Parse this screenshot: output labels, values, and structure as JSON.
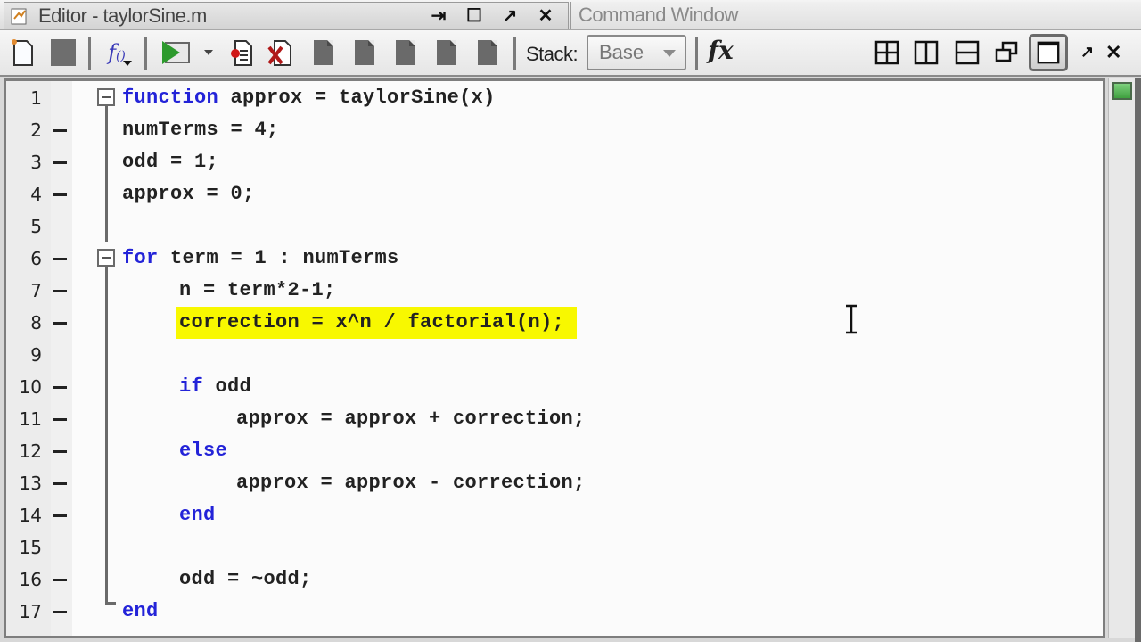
{
  "titlebar": {
    "editor_title": "Editor - taylorSine.m",
    "command_window_title": "Command Window",
    "controls": {
      "dock": "⇥",
      "maximize": "☐",
      "undock": "↗",
      "close": "✕"
    }
  },
  "toolbar": {
    "buttons": [
      {
        "name": "new-file",
        "icon": "new-file-icon"
      },
      {
        "name": "save",
        "icon": "save-icon"
      },
      {
        "name": "insert-function",
        "icon": "function-icon"
      },
      {
        "name": "run",
        "icon": "run-icon"
      },
      {
        "name": "run-options",
        "icon": "dropdown-arrow-icon"
      },
      {
        "name": "set-breakpoint",
        "icon": "breakpoint-icon"
      },
      {
        "name": "clear-breakpoints",
        "icon": "clear-breakpoints-icon"
      },
      {
        "name": "step",
        "icon": "step-icon"
      },
      {
        "name": "step-in",
        "icon": "step-in-icon"
      },
      {
        "name": "step-out",
        "icon": "step-out-icon"
      },
      {
        "name": "continue",
        "icon": "continue-icon"
      },
      {
        "name": "exit-debug",
        "icon": "exit-debug-icon"
      }
    ],
    "stack_label": "Stack:",
    "stack_value": "Base",
    "fx_label": "fx",
    "layout_buttons": [
      "tile-2x2",
      "split-columns",
      "split-rows",
      "float",
      "single"
    ],
    "undock": "↗",
    "close": "✕"
  },
  "editor": {
    "highlight_color": "#f8f800",
    "keyword_color": "#2323d8",
    "lines": [
      {
        "num": "1",
        "breakpoint_dash": false,
        "indent": 0,
        "tokens": [
          [
            "kw",
            "function"
          ],
          [
            "t",
            " approx = taylorSine(x)"
          ]
        ]
      },
      {
        "num": "2",
        "breakpoint_dash": true,
        "indent": 0,
        "tokens": [
          [
            "t",
            "numTerms = 4;"
          ]
        ]
      },
      {
        "num": "3",
        "breakpoint_dash": true,
        "indent": 0,
        "tokens": [
          [
            "t",
            "odd = 1;"
          ]
        ]
      },
      {
        "num": "4",
        "breakpoint_dash": true,
        "indent": 0,
        "tokens": [
          [
            "t",
            "approx = 0;"
          ]
        ]
      },
      {
        "num": "5",
        "breakpoint_dash": false,
        "indent": 0,
        "tokens": []
      },
      {
        "num": "6",
        "breakpoint_dash": true,
        "indent": 0,
        "tokens": [
          [
            "kw",
            "for"
          ],
          [
            "t",
            " term = 1 : numTerms"
          ]
        ]
      },
      {
        "num": "7",
        "breakpoint_dash": true,
        "indent": 1,
        "tokens": [
          [
            "t",
            "n = term*2-1;"
          ]
        ]
      },
      {
        "num": "8",
        "breakpoint_dash": true,
        "indent": 1,
        "highlighted": true,
        "tokens": [
          [
            "t",
            "correction = x^n / factorial(n);"
          ]
        ]
      },
      {
        "num": "9",
        "breakpoint_dash": false,
        "indent": 0,
        "tokens": []
      },
      {
        "num": "10",
        "breakpoint_dash": true,
        "indent": 1,
        "tokens": [
          [
            "kw",
            "if"
          ],
          [
            "t",
            " odd"
          ]
        ]
      },
      {
        "num": "11",
        "breakpoint_dash": true,
        "indent": 2,
        "tokens": [
          [
            "t",
            "approx = approx + correction;"
          ]
        ]
      },
      {
        "num": "12",
        "breakpoint_dash": true,
        "indent": 1,
        "tokens": [
          [
            "kw",
            "else"
          ]
        ]
      },
      {
        "num": "13",
        "breakpoint_dash": true,
        "indent": 2,
        "tokens": [
          [
            "t",
            "approx = approx - correction;"
          ]
        ]
      },
      {
        "num": "14",
        "breakpoint_dash": true,
        "indent": 1,
        "tokens": [
          [
            "kw",
            "end"
          ]
        ]
      },
      {
        "num": "15",
        "breakpoint_dash": false,
        "indent": 0,
        "tokens": []
      },
      {
        "num": "16",
        "breakpoint_dash": true,
        "indent": 1,
        "tokens": [
          [
            "t",
            "odd = ~odd;"
          ]
        ]
      },
      {
        "num": "17",
        "breakpoint_dash": true,
        "indent": 0,
        "tokens": [
          [
            "kw",
            "end"
          ]
        ]
      }
    ]
  },
  "status": {
    "code_analyzer": "no-issues",
    "indicator_color": "#5cbf5c"
  }
}
